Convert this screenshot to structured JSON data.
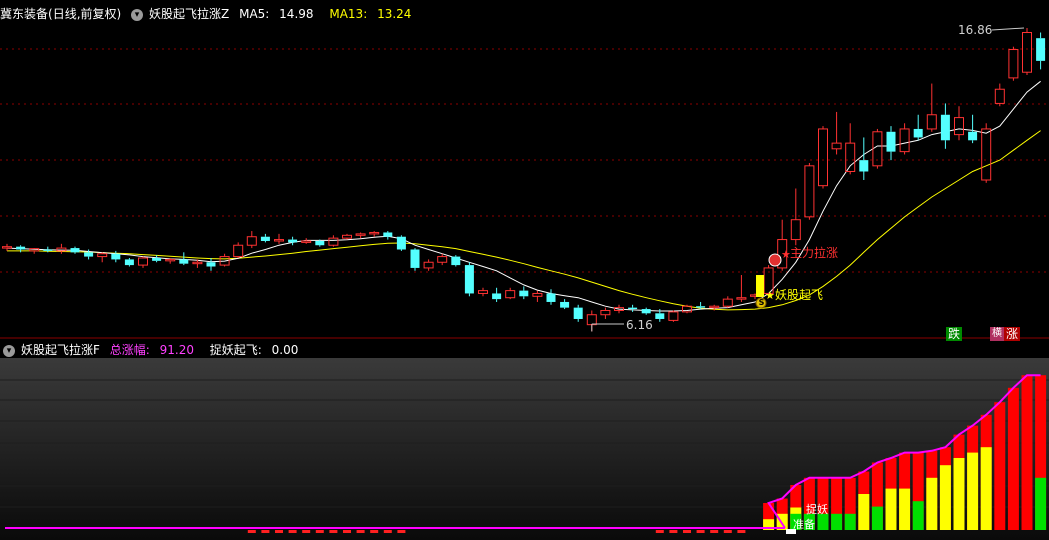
{
  "main_header": {
    "stock_name": "冀东装备",
    "period": "(日线,前复权)",
    "indicator_name": "妖股起飞拉涨Z",
    "ma5_label": "MA5:",
    "ma5_value": "14.98",
    "ma13_label": "MA13:",
    "ma13_value": "13.24"
  },
  "sub_header": {
    "indicator_name": "妖股起飞拉涨F",
    "total_gain_label": "总涨幅:",
    "total_gain_value": "91.20",
    "catch_label": "捉妖起飞:",
    "catch_value": "0.00"
  },
  "annotations": {
    "high_price": "16.86",
    "low_price": "6.16",
    "signal_main_force": "主力拉涨",
    "signal_takeoff": "妖股起飞",
    "coin_glyph": "S",
    "badge_down": "跌",
    "badge_up": "涨",
    "badge_extra": "横",
    "sub_signal_1": "捉妖",
    "sub_signal_2": "准备"
  },
  "colors": {
    "up": "#ff3232",
    "down": "#54ffff",
    "ma5": "#ffffff",
    "ma13": "#ffff00",
    "grid": "#8b0000",
    "bar_red": "#ff0000",
    "bar_yellow": "#ffff00",
    "bar_green": "#00e000",
    "magenta": "#ff00ff"
  },
  "chart_data": {
    "type": "candlestick",
    "candles": [
      [
        9.1,
        9.25,
        9.0,
        9.15
      ],
      [
        9.15,
        9.2,
        8.95,
        9.05
      ],
      [
        9.0,
        9.1,
        8.9,
        9.08
      ],
      [
        9.05,
        9.15,
        8.95,
        9.0
      ],
      [
        9.0,
        9.25,
        8.9,
        9.1
      ],
      [
        9.1,
        9.15,
        8.9,
        8.95
      ],
      [
        8.95,
        9.05,
        8.7,
        8.8
      ],
      [
        8.8,
        8.95,
        8.6,
        8.9
      ],
      [
        8.9,
        9.0,
        8.6,
        8.7
      ],
      [
        8.7,
        8.75,
        8.45,
        8.5
      ],
      [
        8.5,
        8.8,
        8.4,
        8.75
      ],
      [
        8.75,
        8.85,
        8.6,
        8.65
      ],
      [
        8.65,
        8.75,
        8.55,
        8.7
      ],
      [
        8.7,
        8.95,
        8.5,
        8.55
      ],
      [
        8.55,
        8.7,
        8.4,
        8.6
      ],
      [
        8.6,
        8.75,
        8.3,
        8.45
      ],
      [
        8.5,
        8.9,
        8.45,
        8.8
      ],
      [
        8.8,
        9.3,
        8.75,
        9.2
      ],
      [
        9.2,
        9.7,
        9.1,
        9.5
      ],
      [
        9.5,
        9.6,
        9.3,
        9.35
      ],
      [
        9.35,
        9.6,
        9.25,
        9.4
      ],
      [
        9.4,
        9.5,
        9.2,
        9.3
      ],
      [
        9.3,
        9.45,
        9.25,
        9.35
      ],
      [
        9.35,
        9.4,
        9.15,
        9.2
      ],
      [
        9.2,
        9.55,
        9.15,
        9.45
      ],
      [
        9.45,
        9.6,
        9.4,
        9.55
      ],
      [
        9.55,
        9.65,
        9.45,
        9.6
      ],
      [
        9.6,
        9.7,
        9.5,
        9.65
      ],
      [
        9.65,
        9.7,
        9.4,
        9.5
      ],
      [
        9.5,
        9.55,
        9.0,
        9.05
      ],
      [
        9.05,
        9.1,
        8.3,
        8.4
      ],
      [
        8.4,
        8.7,
        8.3,
        8.6
      ],
      [
        8.6,
        8.9,
        8.5,
        8.8
      ],
      [
        8.8,
        8.85,
        8.45,
        8.5
      ],
      [
        8.5,
        8.6,
        7.4,
        7.5
      ],
      [
        7.5,
        7.7,
        7.4,
        7.6
      ],
      [
        7.5,
        7.7,
        7.2,
        7.3
      ],
      [
        7.35,
        7.7,
        7.3,
        7.6
      ],
      [
        7.6,
        7.75,
        7.3,
        7.4
      ],
      [
        7.4,
        7.6,
        7.2,
        7.5
      ],
      [
        7.5,
        7.65,
        7.1,
        7.2
      ],
      [
        7.2,
        7.3,
        6.95,
        7.0
      ],
      [
        7.0,
        7.1,
        6.5,
        6.6
      ],
      [
        6.4,
        6.9,
        6.16,
        6.75
      ],
      [
        6.75,
        7.0,
        6.6,
        6.9
      ],
      [
        6.9,
        7.1,
        6.8,
        7.0
      ],
      [
        7.0,
        7.1,
        6.85,
        6.95
      ],
      [
        6.95,
        7.0,
        6.75,
        6.8
      ],
      [
        6.8,
        6.95,
        6.5,
        6.6
      ],
      [
        6.55,
        6.9,
        6.5,
        6.85
      ],
      [
        6.85,
        7.1,
        6.8,
        7.05
      ],
      [
        7.05,
        7.2,
        6.95,
        7.0
      ],
      [
        7.0,
        7.1,
        6.9,
        7.05
      ],
      [
        7.05,
        7.4,
        7.0,
        7.3
      ],
      [
        7.3,
        8.15,
        7.2,
        7.35
      ],
      [
        7.4,
        7.5,
        7.3,
        7.45
      ],
      [
        7.5,
        8.5,
        7.4,
        8.4
      ],
      [
        8.4,
        10.1,
        8.3,
        9.4
      ],
      [
        9.4,
        11.2,
        9.2,
        10.1
      ],
      [
        10.2,
        12.1,
        10.1,
        12.0
      ],
      [
        11.3,
        13.4,
        11.2,
        13.3
      ],
      [
        12.6,
        13.9,
        12.4,
        12.8
      ],
      [
        11.8,
        13.5,
        11.7,
        12.8
      ],
      [
        12.2,
        13.0,
        11.5,
        11.8
      ],
      [
        12.0,
        13.3,
        11.9,
        13.2
      ],
      [
        13.2,
        13.4,
        12.2,
        12.5
      ],
      [
        12.5,
        13.5,
        12.4,
        13.3
      ],
      [
        13.3,
        13.8,
        12.9,
        13.0
      ],
      [
        13.3,
        14.9,
        13.2,
        13.8
      ],
      [
        13.8,
        14.2,
        12.6,
        12.9
      ],
      [
        13.1,
        14.1,
        12.9,
        13.7
      ],
      [
        13.2,
        13.8,
        12.8,
        12.9
      ],
      [
        11.5,
        13.5,
        11.4,
        13.3
      ],
      [
        14.2,
        14.9,
        14.1,
        14.7
      ],
      [
        15.1,
        16.2,
        15.0,
        16.1
      ],
      [
        15.3,
        16.86,
        15.2,
        16.7
      ],
      [
        16.5,
        16.7,
        15.4,
        15.7
      ]
    ],
    "ma5": [
      9.1,
      9.08,
      9.06,
      9.04,
      9.03,
      9.02,
      8.98,
      8.94,
      8.9,
      8.86,
      8.8,
      8.76,
      8.72,
      8.7,
      8.67,
      8.62,
      8.64,
      8.74,
      8.92,
      9.05,
      9.2,
      9.3,
      9.37,
      9.37,
      9.37,
      9.39,
      9.43,
      9.48,
      9.52,
      9.43,
      9.2,
      9.05,
      8.9,
      8.75,
      8.6,
      8.45,
      8.3,
      8.05,
      7.8,
      7.62,
      7.5,
      7.42,
      7.35,
      7.2,
      7.05,
      6.95,
      6.92,
      6.9,
      6.88,
      6.88,
      6.9,
      6.95,
      6.98,
      7.0,
      7.1,
      7.2,
      7.5,
      8.0,
      8.6,
      9.4,
      10.4,
      11.3,
      12.0,
      12.4,
      12.7,
      12.7,
      12.8,
      12.9,
      13.1,
      13.2,
      13.3,
      13.25,
      13.15,
      13.4,
      14.0,
      14.6,
      14.98
    ],
    "ma13": [
      9.0,
      9.0,
      9.0,
      8.99,
      8.98,
      8.97,
      8.96,
      8.94,
      8.92,
      8.9,
      8.87,
      8.84,
      8.81,
      8.78,
      8.75,
      8.73,
      8.72,
      8.74,
      8.78,
      8.82,
      8.87,
      8.92,
      8.98,
      9.03,
      9.08,
      9.13,
      9.18,
      9.23,
      9.27,
      9.28,
      9.25,
      9.2,
      9.15,
      9.08,
      8.98,
      8.88,
      8.78,
      8.67,
      8.55,
      8.42,
      8.3,
      8.18,
      8.05,
      7.9,
      7.75,
      7.6,
      7.47,
      7.35,
      7.24,
      7.14,
      7.05,
      6.98,
      6.94,
      6.92,
      6.93,
      6.95,
      7.0,
      7.1,
      7.25,
      7.45,
      7.75,
      8.1,
      8.5,
      8.95,
      9.4,
      9.8,
      10.2,
      10.55,
      10.9,
      11.2,
      11.5,
      11.8,
      12.0,
      12.2,
      12.55,
      12.9,
      13.24
    ],
    "sub_red": [
      0,
      0,
      0,
      0,
      0,
      0,
      0,
      0,
      0,
      0,
      0,
      0,
      0,
      0,
      0,
      0,
      0,
      0,
      0,
      0,
      0,
      0,
      0,
      0,
      0,
      0,
      0,
      0,
      0,
      0,
      0,
      0,
      0,
      0,
      0,
      0,
      0,
      0,
      0,
      0,
      0,
      0,
      0,
      0,
      0,
      0,
      0,
      0,
      0,
      0,
      0,
      0,
      0,
      0,
      0,
      0,
      0.3,
      0.35,
      0.5,
      0.58,
      0.58,
      0.58,
      0.58,
      0.65,
      0.75,
      0.8,
      0.86,
      0.86,
      0.88,
      0.92,
      1.06,
      1.16,
      1.28,
      1.42,
      1.58,
      1.72,
      1.72
    ],
    "sub_yellow": [
      0,
      0,
      0,
      0,
      0,
      0,
      0,
      0,
      0,
      0,
      0,
      0,
      0,
      0,
      0,
      0,
      0,
      0,
      0,
      0,
      0,
      0,
      0,
      0,
      0,
      0,
      0,
      0,
      0,
      0,
      0,
      0,
      0,
      0,
      0,
      0,
      0,
      0,
      0,
      0,
      0,
      0,
      0,
      0,
      0,
      0,
      0,
      0,
      0,
      0,
      0,
      0,
      0,
      0,
      0,
      0,
      0.12,
      0.18,
      0.25,
      0,
      0,
      0,
      0,
      0.4,
      0,
      0.46,
      0.46,
      0,
      0.58,
      0.72,
      0.8,
      0.86,
      0.92,
      0,
      0,
      0,
      0
    ],
    "sub_green": [
      0,
      0,
      0,
      0,
      0,
      0,
      0,
      0,
      0,
      0,
      0,
      0,
      0,
      0,
      0,
      0,
      0,
      0,
      0,
      0,
      0,
      0,
      0,
      0,
      0,
      0,
      0,
      0,
      0,
      0,
      0,
      0,
      0,
      0,
      0,
      0,
      0,
      0,
      0,
      0,
      0,
      0,
      0,
      0,
      0,
      0,
      0,
      0,
      0,
      0,
      0,
      0,
      0,
      0,
      0,
      0,
      0,
      0,
      0.18,
      0.18,
      0.18,
      0.18,
      0.18,
      0,
      0.26,
      0,
      0,
      0.32,
      0,
      0,
      0,
      0,
      0,
      0,
      0,
      0,
      0.58
    ]
  }
}
